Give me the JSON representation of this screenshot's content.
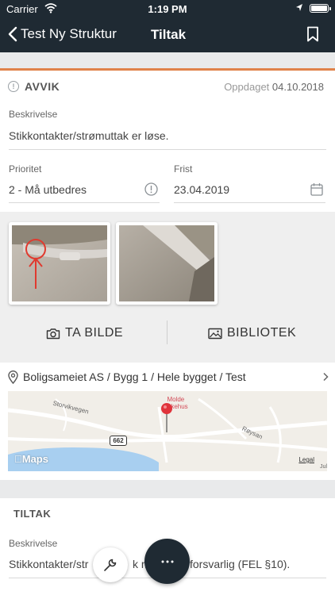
{
  "status_bar": {
    "carrier": "Carrier",
    "time": "1:19 PM"
  },
  "nav": {
    "back_label": "Test Ny Struktur",
    "title": "Tiltak"
  },
  "avvik": {
    "heading": "AVVIK",
    "found_label": "Oppdaget",
    "found_date": "04.10.2018",
    "description_label": "Beskrivelse",
    "description_value": "Stikkontakter/strømuttak er løse.",
    "priority_label": "Prioritet",
    "priority_value": "2 - Må utbedres",
    "deadline_label": "Frist",
    "deadline_value": "23.04.2019"
  },
  "actions": {
    "camera_label": "TA BILDE",
    "library_label": "BIBLIOTEK"
  },
  "location": {
    "path": "Boligsameiet AS / Bygg 1 / Hele bygget / Test",
    "map": {
      "street_1": "Storvikvegen",
      "street_2": "Røysan",
      "poi_line_1": "Molde",
      "poi_line_2": "Sykehus",
      "road_number": "662",
      "maps_label": "Maps",
      "legal_label": "Legal",
      "corner_text": "Jul"
    }
  },
  "tiltak": {
    "heading": "TILTAK",
    "description_label": "Beskrivelse",
    "description_value_left": "Stikkontakter/str",
    "description_value_mid": "k m",
    "description_value_right": "forsvarlig (FEL §10)."
  },
  "icons": {
    "back": "chevron-left-icon",
    "bookmark": "bookmark-icon",
    "warning": "alert-circle-icon",
    "calendar": "calendar-icon",
    "camera": "camera-icon",
    "image": "image-icon",
    "pin": "location-pin-icon",
    "wrench": "wrench-icon",
    "more": "more-horizontal-icon"
  },
  "colors": {
    "nav_bg": "#1f2a33",
    "accent": "#e0824a",
    "pin": "#e0333b"
  }
}
